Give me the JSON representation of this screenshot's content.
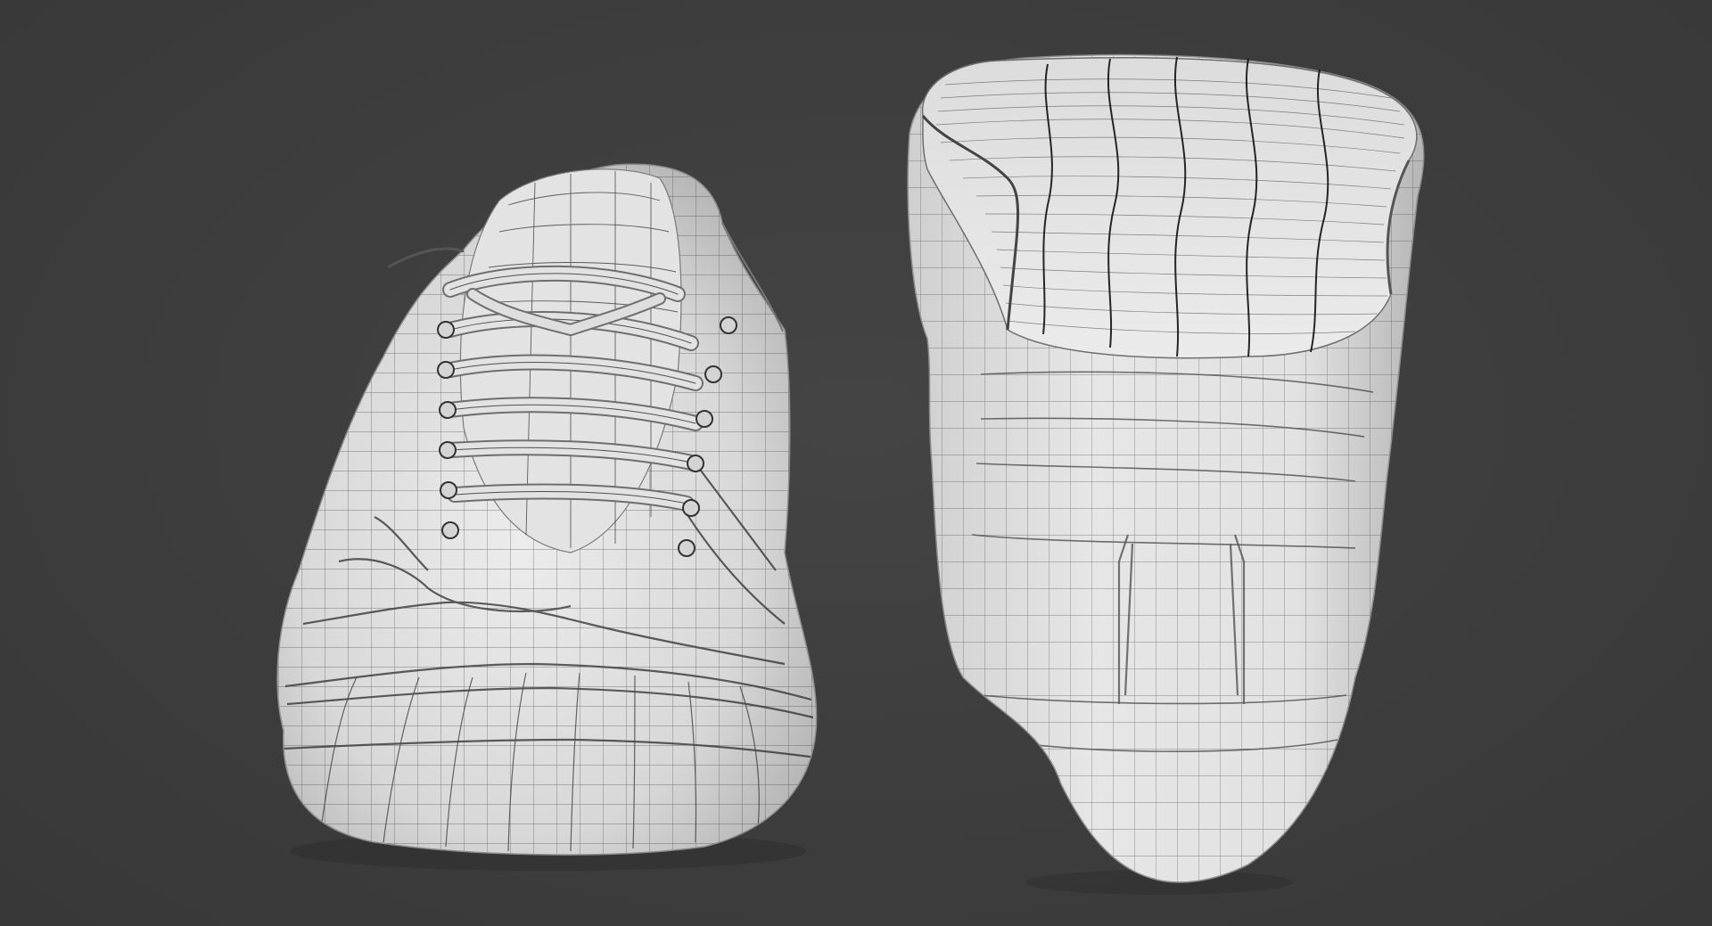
{
  "scene": {
    "background_color": "#3d3d3d",
    "mesh_color": "#e4e4e4",
    "mesh_shadow_color": "#9a9a9a",
    "wire_color": "#1e1e1e",
    "objects": [
      {
        "name": "sneaker-front-view",
        "view": "front",
        "has_laces": true,
        "eyelets_per_side": 6
      },
      {
        "name": "sneaker-back-view",
        "view": "back",
        "has_laces": false
      }
    ]
  }
}
